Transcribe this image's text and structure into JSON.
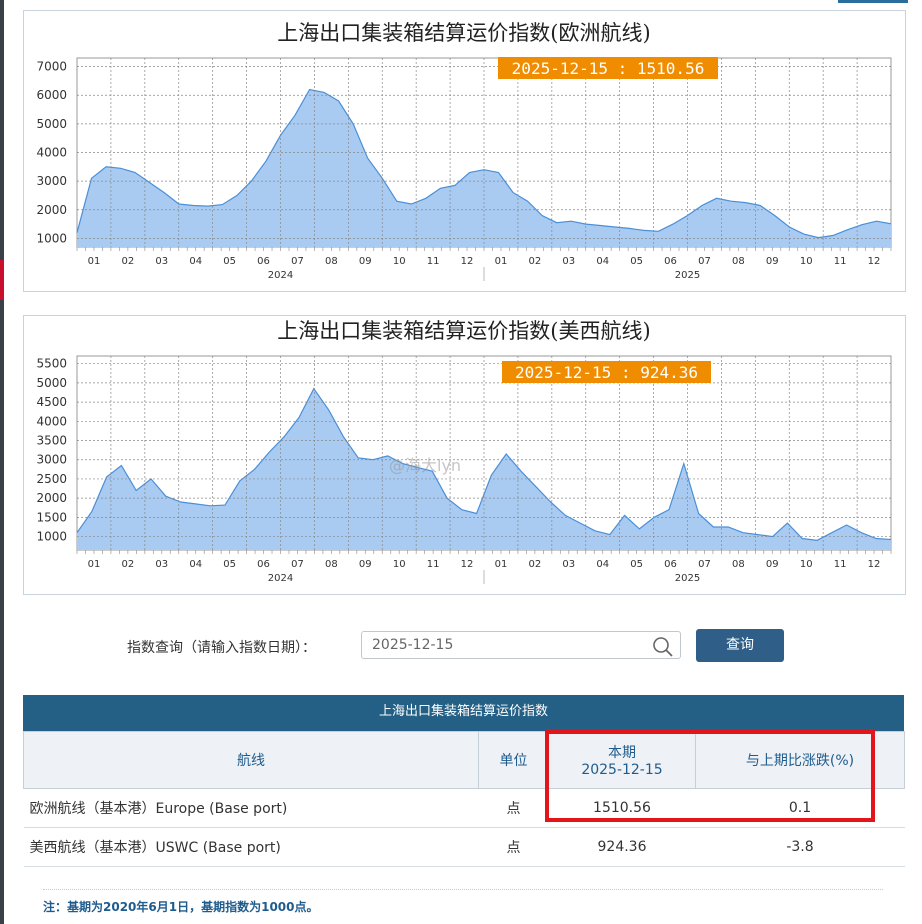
{
  "query": {
    "label": "指数查询（请输入指数日期）：",
    "value": "2025-12-15",
    "button": "查询"
  },
  "table": {
    "title": "上海出口集装箱结算运价指数",
    "headers": {
      "route": "航线",
      "unit": "单位",
      "current_line1": "本期",
      "current_line2": "2025-12-15",
      "change": "与上期比涨跌(%)"
    },
    "rows": [
      {
        "route": "欧洲航线（基本港）Europe (Base port)",
        "unit": "点",
        "value": "1510.56",
        "change": "0.1"
      },
      {
        "route": "美西航线（基本港）USWC (Base port)",
        "unit": "点",
        "value": "924.36",
        "change": "-3.8"
      }
    ]
  },
  "note": "注：基期为2020年6月1日，基期指数为1000点。",
  "watermark": "@海大lyn",
  "colors": {
    "area_fill": "#a9cbf2",
    "area_line": "#4a8fd8",
    "tooltip_bg": "#f08c00",
    "highlight": "#e3141a",
    "header_bg": "#245f85"
  },
  "chart_data": [
    {
      "type": "area",
      "title": "上海出口集装箱结算运价指数(欧洲航线)",
      "tooltip": "2025-12-15 : 1510.56",
      "ylim": [
        700,
        7300
      ],
      "yticks": [
        1000,
        2000,
        3000,
        4000,
        5000,
        6000,
        7000
      ],
      "month_labels": [
        "01",
        "02",
        "03",
        "04",
        "05",
        "06",
        "07",
        "08",
        "09",
        "10",
        "11",
        "12",
        "01",
        "02",
        "03",
        "04",
        "05",
        "06",
        "07",
        "08",
        "09",
        "10",
        "11",
        "12"
      ],
      "year_labels": [
        "2024",
        "2025"
      ],
      "grid": true,
      "x": [
        0,
        0.5,
        1,
        1.5,
        2,
        2.5,
        3,
        3.5,
        4,
        4.5,
        5,
        5.5,
        6,
        6.5,
        7,
        7.5,
        8,
        8.5,
        9,
        9.5,
        10,
        10.5,
        11,
        11.5,
        12,
        12.5,
        13,
        13.5,
        14,
        14.5,
        15,
        15.5,
        16,
        16.5,
        17,
        17.5,
        18,
        18.5,
        19,
        19.5,
        20,
        20.5,
        21,
        21.5,
        22,
        22.5,
        23,
        23.5
      ],
      "values": [
        1200,
        3100,
        3500,
        3450,
        3300,
        2950,
        2600,
        2200,
        2150,
        2130,
        2180,
        2500,
        3000,
        3700,
        4600,
        5300,
        6200,
        6100,
        5800,
        5000,
        3800,
        3100,
        2300,
        2200,
        2400,
        2750,
        2850,
        3300,
        3400,
        3300,
        2600,
        2300,
        1800,
        1550,
        1600,
        1500,
        1450,
        1400,
        1350,
        1280,
        1250,
        1500,
        1800,
        2150,
        2400,
        2300,
        2250,
        2150,
        1800,
        1400,
        1150,
        1030,
        1100,
        1300,
        1480,
        1600,
        1510
      ]
    },
    {
      "type": "area",
      "title": "上海出口集装箱结算运价指数(美西航线)",
      "tooltip": "2025-12-15 : 924.36",
      "ylim": [
        650,
        5700
      ],
      "yticks": [
        1000,
        1500,
        2000,
        2500,
        3000,
        3500,
        4000,
        4500,
        5000,
        5500
      ],
      "month_labels": [
        "01",
        "02",
        "03",
        "04",
        "05",
        "06",
        "07",
        "08",
        "09",
        "10",
        "11",
        "12",
        "01",
        "02",
        "03",
        "04",
        "05",
        "06",
        "07",
        "08",
        "09",
        "10",
        "11",
        "12"
      ],
      "year_labels": [
        "2024",
        "2025"
      ],
      "grid": true,
      "values": [
        1100,
        1650,
        2550,
        2850,
        2200,
        2500,
        2050,
        1900,
        1850,
        1800,
        1820,
        2450,
        2750,
        3200,
        3600,
        4100,
        4850,
        4300,
        3600,
        3050,
        3000,
        3100,
        2900,
        2800,
        2700,
        2000,
        1700,
        1600,
        2600,
        3150,
        2700,
        2300,
        1900,
        1550,
        1350,
        1150,
        1050,
        1550,
        1200,
        1500,
        1700,
        2900,
        1600,
        1250,
        1250,
        1100,
        1050,
        1000,
        1350,
        950,
        900,
        1100,
        1300,
        1100,
        950,
        924
      ]
    }
  ]
}
